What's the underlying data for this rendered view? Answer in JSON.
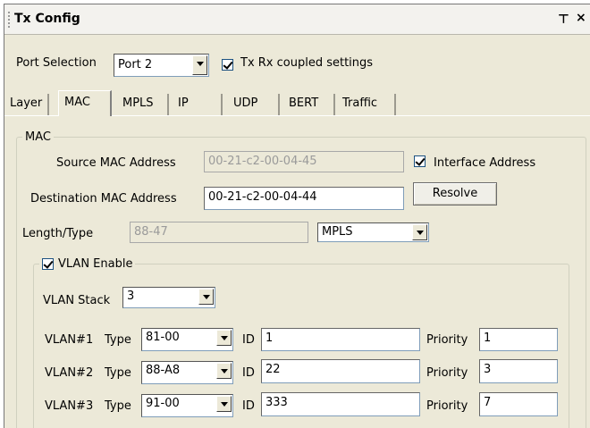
{
  "window": {
    "title": "Tx Config",
    "pin_glyph": "#",
    "close_glyph": "×"
  },
  "port": {
    "label": "Port Selection",
    "value": "Port 2",
    "coupled_label": "Tx Rx coupled settings",
    "coupled_checked": true
  },
  "tabs": [
    {
      "label": "Layer",
      "active": false
    },
    {
      "label": "MAC",
      "active": true
    },
    {
      "label": "MPLS",
      "active": false
    },
    {
      "label": "IP",
      "active": false
    },
    {
      "label": "UDP",
      "active": false
    },
    {
      "label": "BERT",
      "active": false
    },
    {
      "label": "Traffic",
      "active": false
    }
  ],
  "mac": {
    "group_label": "MAC",
    "source_label": "Source MAC Address",
    "source_value": "00-21-c2-00-04-45",
    "interface_label": "Interface Address",
    "interface_checked": true,
    "dest_label": "Destination MAC Address",
    "dest_value": "00-21-c2-00-04-44",
    "resolve_label": "Resolve",
    "length_label": "Length/Type",
    "length_value": "88-47",
    "protocol_value": "MPLS"
  },
  "vlan": {
    "enable_label": "VLAN Enable",
    "enable_checked": true,
    "stack_label": "VLAN Stack",
    "stack_value": "3",
    "type_label": "Type",
    "id_label": "ID",
    "priority_label": "Priority",
    "rows": [
      {
        "name": "VLAN#1",
        "type": "81-00",
        "id": "1",
        "priority": "1"
      },
      {
        "name": "VLAN#2",
        "type": "88-A8",
        "id": "22",
        "priority": "3"
      },
      {
        "name": "VLAN#3",
        "type": "91-00",
        "id": "333",
        "priority": "7"
      }
    ]
  },
  "colors": {
    "panel": "#ece9d8",
    "input_border": "#7f9db9"
  }
}
